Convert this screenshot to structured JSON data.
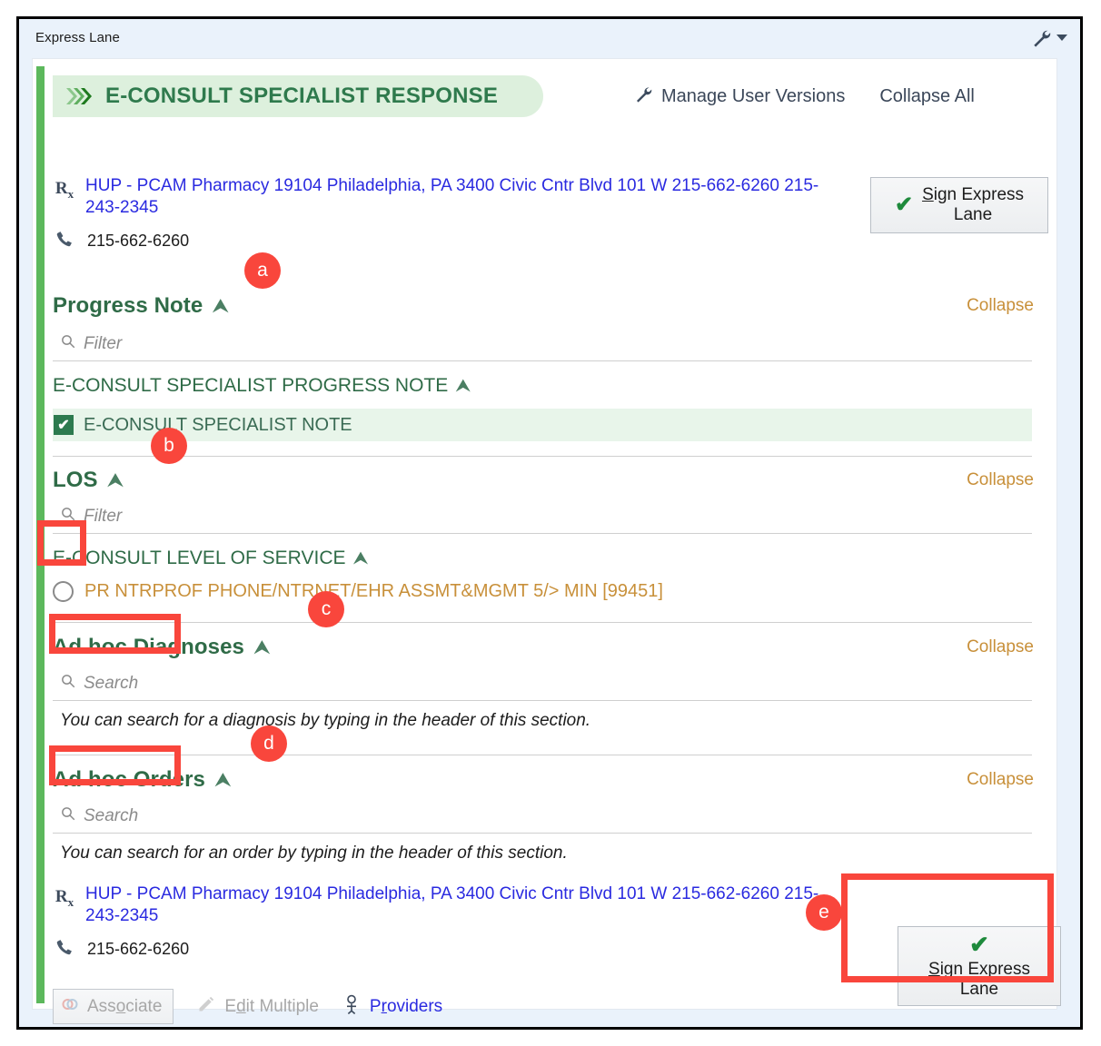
{
  "window": {
    "title": "Express Lane",
    "tools_icon": "wrench-icon",
    "caret_icon": "chevron-down-icon"
  },
  "banner": {
    "icon": "double-chevron-right-icon",
    "title": "E-CONSULT SPECIALIST RESPONSE",
    "manage_versions_icon": "wrench-icon",
    "manage_versions_label": "Manage User Versions",
    "collapse_all_label": "Collapse All"
  },
  "pharmacy": {
    "rx_icon": "rx-icon",
    "link_text": "HUP - PCAM Pharmacy 19104 Philadelphia, PA 3400 Civic Cntr Blvd 101 W 215-662-6260 215-243-2345",
    "phone_icon": "phone-icon",
    "phone": "215-662-6260"
  },
  "sign_button": {
    "check_icon": "check-icon",
    "label_first": "S",
    "label_rest": "ign Express",
    "label_line2": "Lane"
  },
  "sections": [
    {
      "id": "progress-note",
      "title": "Progress Note",
      "chevron_icon": "chevron-up-icon",
      "collapse_label": "Collapse",
      "filter_icon": "search-icon",
      "filter_placeholder": "Filter",
      "sub_head": "E-CONSULT SPECIALIST PROGRESS NOTE",
      "sub_head_chevron_icon": "chevron-up-icon",
      "item_checkbox_icon": "checkbox-checked-icon",
      "item_label": "E-CONSULT SPECIALIST NOTE"
    },
    {
      "id": "los",
      "title": "LOS",
      "chevron_icon": "chevron-up-icon",
      "collapse_label": "Collapse",
      "filter_icon": "search-icon",
      "filter_placeholder": "Filter",
      "sub_head": "E-CONSULT LEVEL OF SERVICE",
      "sub_head_chevron_icon": "chevron-up-icon",
      "radio_icon": "radio-unchecked-icon",
      "radio_label": "PR NTRPROF PHONE/NTRNET/EHR ASSMT&MGMT 5/> MIN [99451]"
    },
    {
      "id": "ad-hoc-diagnoses",
      "title": "Ad hoc Diagnoses",
      "chevron_icon": "chevron-up-icon",
      "collapse_label": "Collapse",
      "search_icon": "search-icon",
      "search_placeholder": "Search",
      "hint": "You can search for a diagnosis by typing in the header of this section."
    },
    {
      "id": "ad-hoc-orders",
      "title": "Ad hoc Orders",
      "chevron_icon": "chevron-up-icon",
      "collapse_label": "Collapse",
      "search_icon": "search-icon",
      "search_placeholder": "Search",
      "hint": "You can search for an order by typing in the header of this section."
    }
  ],
  "footer": {
    "associate_icon": "associate-icon",
    "associate_first": "Ass",
    "associate_mid": "o",
    "associate_rest": "ciate",
    "edit_icon": "pencil-icon",
    "edit_first": "E",
    "edit_mid": "d",
    "edit_rest": "it Multiple",
    "providers_icon": "person-icon",
    "providers_first": "P",
    "providers_mid": "r",
    "providers_rest": "oviders"
  },
  "annotations": [
    {
      "id": "a",
      "label": "a"
    },
    {
      "id": "b",
      "label": "b"
    },
    {
      "id": "c",
      "label": "c"
    },
    {
      "id": "d",
      "label": "d"
    },
    {
      "id": "e",
      "label": "e"
    }
  ],
  "colors": {
    "accent_green": "#5cb85c",
    "banner_bg": "#ddf0dd",
    "banner_text": "#2f7a4d",
    "link_blue": "#2a2ae0",
    "annotation_red": "#f9463c",
    "section_title": "#2f6b47",
    "collapse_link": "#c8903a"
  }
}
